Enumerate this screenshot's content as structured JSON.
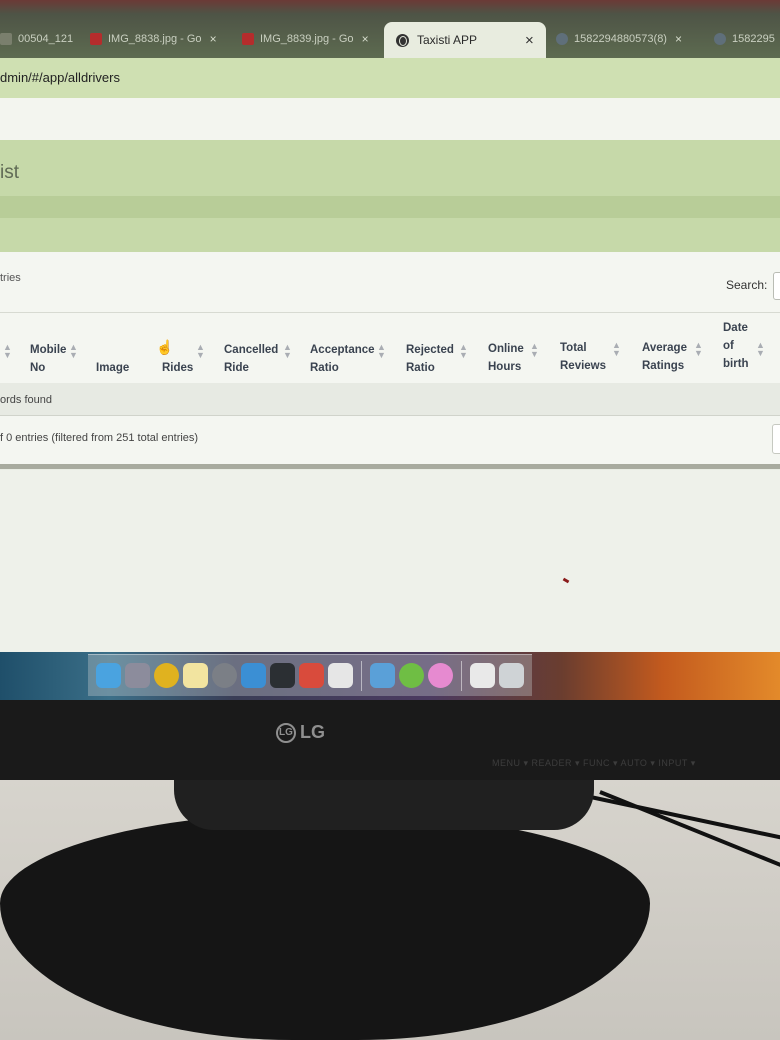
{
  "browser": {
    "tabs": [
      {
        "label": "00504_121",
        "color": "#7a7f6d"
      },
      {
        "label": "IMG_8838.jpg - Go",
        "color": "#b52c2c"
      },
      {
        "label": "IMG_8839.jpg - Go",
        "color": "#b52c2c"
      },
      {
        "label": "Taxisti APP",
        "active": true
      },
      {
        "label": "1582294880573(8)",
        "color": "#5f6f7a"
      },
      {
        "label": "1582295",
        "color": "#5f6f7a"
      }
    ],
    "close_glyph": "×",
    "address": "dmin/#/app/alldrivers"
  },
  "page": {
    "title": "ist"
  },
  "table": {
    "entries_label": "tries",
    "search_label": "Search:",
    "sort_glyph_up": "▲",
    "sort_glyph_down": "▼",
    "columns": [
      {
        "line1": "Mobile",
        "line2": "No"
      },
      {
        "line1": "",
        "line2": "Image"
      },
      {
        "line1": "",
        "line2": "Rides"
      },
      {
        "line1": "Cancelled",
        "line2": "Ride"
      },
      {
        "line1": "Acceptance",
        "line2": "Ratio"
      },
      {
        "line1": "Rejected",
        "line2": "Ratio"
      },
      {
        "line1": "Online",
        "line2": "Hours"
      },
      {
        "line1": "Total",
        "line2": "Reviews"
      },
      {
        "line1": "Average",
        "line2": "Ratings"
      },
      {
        "line1": "Date",
        "line2": "of",
        "line3": "birth"
      }
    ],
    "empty_text": "ords found",
    "info_text": "f 0 entries (filtered from 251 total entries)"
  },
  "monitor": {
    "brand": "LG",
    "brand_mark": "LG",
    "buttons": "MENU ▾  READER ▾  FUNC ▾  AUTO ▾  INPUT ▾"
  },
  "dock": {
    "icons": [
      {
        "name": "finder-icon",
        "color": "#4aa3e0"
      },
      {
        "name": "launchpad-icon",
        "color": "#8c8c9c"
      },
      {
        "name": "chrome-icon",
        "color": "#e0b21f"
      },
      {
        "name": "notes-icon",
        "color": "#f2e4a0"
      },
      {
        "name": "system-preferences-icon",
        "color": "#7b7f86"
      },
      {
        "name": "xcode-icon",
        "color": "#3b8fd4"
      },
      {
        "name": "terminal-icon",
        "color": "#2b2f33"
      },
      {
        "name": "drawing-app-icon",
        "color": "#d94b3c"
      },
      {
        "name": "textedit-icon",
        "color": "#e6e6e6"
      },
      {
        "name": "photos-icon",
        "color": "#5aa0d8"
      },
      {
        "name": "upwork-icon",
        "color": "#6fbe44"
      },
      {
        "name": "itunes-icon",
        "color": "#e68ad0"
      },
      {
        "name": "documents-icon",
        "color": "#e9e9e9"
      },
      {
        "name": "trash-icon",
        "color": "#cfd3d6"
      }
    ]
  }
}
